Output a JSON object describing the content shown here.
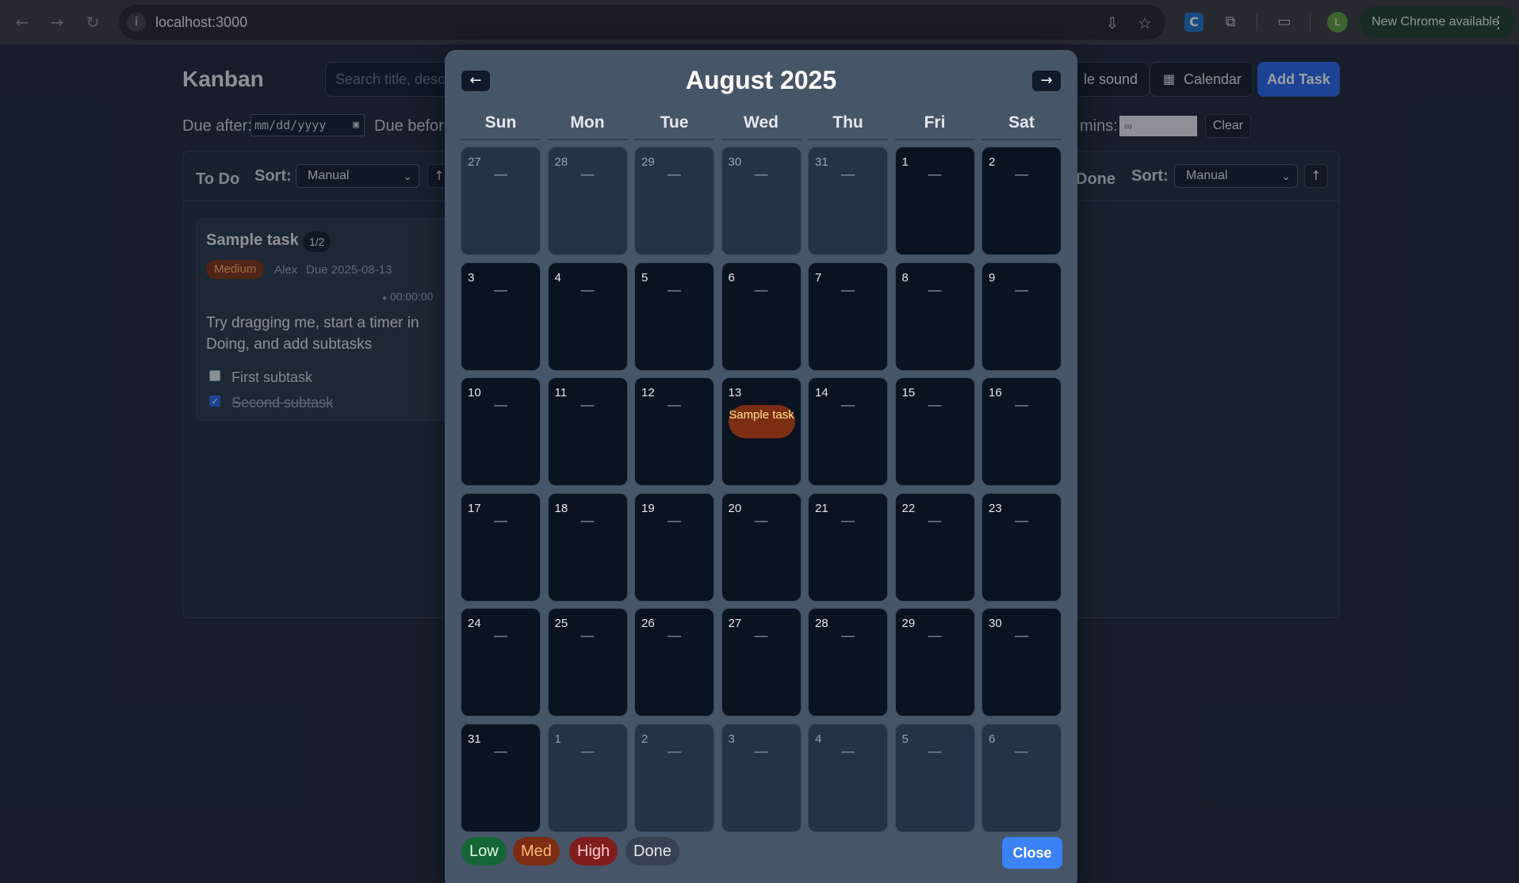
{
  "browser": {
    "url": "localhost:3000",
    "profile_initial": "L",
    "update_label": "New Chrome available",
    "extension_letter": "C",
    "icons": [
      "back-icon",
      "forward-icon",
      "reload-icon",
      "site-info-icon",
      "install-icon",
      "star-icon",
      "extensions-icon",
      "tab-search-icon",
      "menu-dots-icon"
    ]
  },
  "app": {
    "title": "Kanban",
    "search_placeholder": "Search title, descri",
    "sound_btn": "le sound",
    "calendar_btn": "Calendar",
    "add_task_btn": "Add Task",
    "filters": {
      "due_after_label": "Due after:",
      "due_after_value": "mm/dd/yyyy",
      "due_before_label": "Due befor",
      "mins_label": "mins:",
      "mins_value": "∞",
      "clear_btn": "Clear"
    },
    "columns": {
      "todo": {
        "title": "To Do",
        "sort_label": "Sort:",
        "sort_value": "Manual",
        "dir": "↑"
      },
      "done": {
        "title": "Done",
        "sort_label": "Sort:",
        "sort_value": "Manual",
        "dir": "↑"
      }
    },
    "task": {
      "title": "Sample task",
      "count": "1/2",
      "priority": "Medium",
      "assignee": "Alex",
      "due": "Due 2025-08-13",
      "timer": "00:00:00",
      "description": "Try dragging me, start a timer in Doing, and add subtasks",
      "subtasks": [
        {
          "label": "First subtask",
          "done": false
        },
        {
          "label": "Second subtask",
          "done": true
        }
      ]
    }
  },
  "calendar": {
    "title": "August 2025",
    "prev": "←",
    "next": "→",
    "weekdays": [
      "Sun",
      "Mon",
      "Tue",
      "Wed",
      "Thu",
      "Fri",
      "Sat"
    ],
    "empty_marker": "—",
    "weeks": [
      [
        {
          "d": "27",
          "cur": false
        },
        {
          "d": "28",
          "cur": false
        },
        {
          "d": "29",
          "cur": false
        },
        {
          "d": "30",
          "cur": false
        },
        {
          "d": "31",
          "cur": false
        },
        {
          "d": "1",
          "cur": true
        },
        {
          "d": "2",
          "cur": true
        }
      ],
      [
        {
          "d": "3",
          "cur": true
        },
        {
          "d": "4",
          "cur": true
        },
        {
          "d": "5",
          "cur": true
        },
        {
          "d": "6",
          "cur": true
        },
        {
          "d": "7",
          "cur": true
        },
        {
          "d": "8",
          "cur": true
        },
        {
          "d": "9",
          "cur": true
        }
      ],
      [
        {
          "d": "10",
          "cur": true
        },
        {
          "d": "11",
          "cur": true
        },
        {
          "d": "12",
          "cur": true
        },
        {
          "d": "13",
          "cur": true,
          "event": "Sample task"
        },
        {
          "d": "14",
          "cur": true
        },
        {
          "d": "15",
          "cur": true
        },
        {
          "d": "16",
          "cur": true
        }
      ],
      [
        {
          "d": "17",
          "cur": true
        },
        {
          "d": "18",
          "cur": true
        },
        {
          "d": "19",
          "cur": true
        },
        {
          "d": "20",
          "cur": true
        },
        {
          "d": "21",
          "cur": true
        },
        {
          "d": "22",
          "cur": true
        },
        {
          "d": "23",
          "cur": true
        }
      ],
      [
        {
          "d": "24",
          "cur": true
        },
        {
          "d": "25",
          "cur": true
        },
        {
          "d": "26",
          "cur": true
        },
        {
          "d": "27",
          "cur": true
        },
        {
          "d": "28",
          "cur": true
        },
        {
          "d": "29",
          "cur": true
        },
        {
          "d": "30",
          "cur": true
        }
      ],
      [
        {
          "d": "31",
          "cur": true
        },
        {
          "d": "1",
          "cur": false
        },
        {
          "d": "2",
          "cur": false
        },
        {
          "d": "3",
          "cur": false
        },
        {
          "d": "4",
          "cur": false
        },
        {
          "d": "5",
          "cur": false
        },
        {
          "d": "6",
          "cur": false
        }
      ]
    ],
    "legend": [
      {
        "label": "Low",
        "bg": "#166534",
        "fg": "#dcfce7"
      },
      {
        "label": "Med",
        "bg": "#7c2d12",
        "fg": "#fdba74"
      },
      {
        "label": "High",
        "bg": "#7f1d1d",
        "fg": "#fecaca"
      },
      {
        "label": "Done",
        "bg": "#374151",
        "fg": "#e5e7eb"
      }
    ],
    "close_btn": "Close"
  }
}
